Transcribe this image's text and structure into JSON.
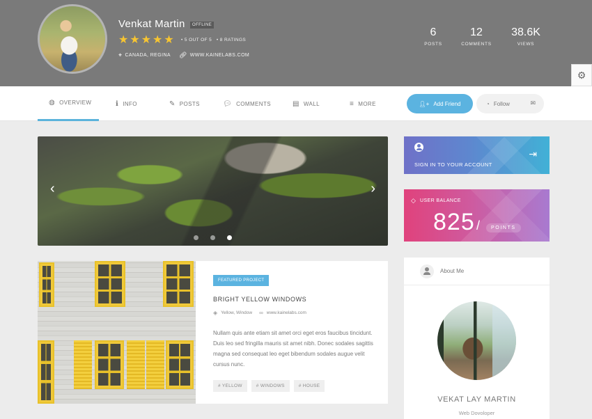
{
  "header": {
    "name": "Venkat Martin",
    "status": "OFFLINE",
    "rating": 5,
    "rating_text": "5 OUT OF 5",
    "ratings_count": "8 RATINGS",
    "location": "CANADA, REGINA",
    "website": "WWW.KAINELABS.COM",
    "stats": [
      {
        "value": "6",
        "label": "POSTS"
      },
      {
        "value": "12",
        "label": "COMMENTS"
      },
      {
        "value": "38.6K",
        "label": "VIEWS"
      }
    ]
  },
  "nav": {
    "tabs": [
      {
        "label": "OVERVIEW",
        "icon": "globe-icon"
      },
      {
        "label": "INFO",
        "icon": "info-icon"
      },
      {
        "label": "POSTS",
        "icon": "pencil-icon"
      },
      {
        "label": "COMMENTS",
        "icon": "comments-icon"
      },
      {
        "label": "WALL",
        "icon": "id-card-icon"
      },
      {
        "label": "MORE",
        "icon": "menu-icon"
      }
    ],
    "active_tab": "OVERVIEW",
    "add_friend": "Add Friend",
    "follow": "Follow"
  },
  "slider": {
    "slide_count": 3,
    "active_slide": 3
  },
  "project": {
    "badge": "FEATURED PROJECT",
    "title": "BRIGHT YELLOW WINDOWS",
    "tags_inline": "Yellow, Window",
    "link": "www.kainelabs.com",
    "description": "Nullam quis ante etiam sit amet orci eget eros faucibus tincidunt. Duis leo sed fringilla mauris sit amet nibh. Donec sodales sagittis magna sed consequat leo eget bibendum sodales augue velit cursus nunc.",
    "tags": [
      "# YELLOW",
      "# WINDOWS",
      "# HOUSE"
    ]
  },
  "sidebar": {
    "signin_label": "SIGN IN TO YOUR ACCOUNT",
    "balance_label": "USER BALANCE",
    "balance_value": "825",
    "balance_slash": "/",
    "balance_unit": "POINTS",
    "about_title": "About Me",
    "about_name": "VEKAT LAY MARTIN",
    "about_role": "Web Dovoloper"
  },
  "colors": {
    "accent": "#5bb3e0",
    "star": "#f7c531",
    "header_bg": "#7a7a7a"
  }
}
